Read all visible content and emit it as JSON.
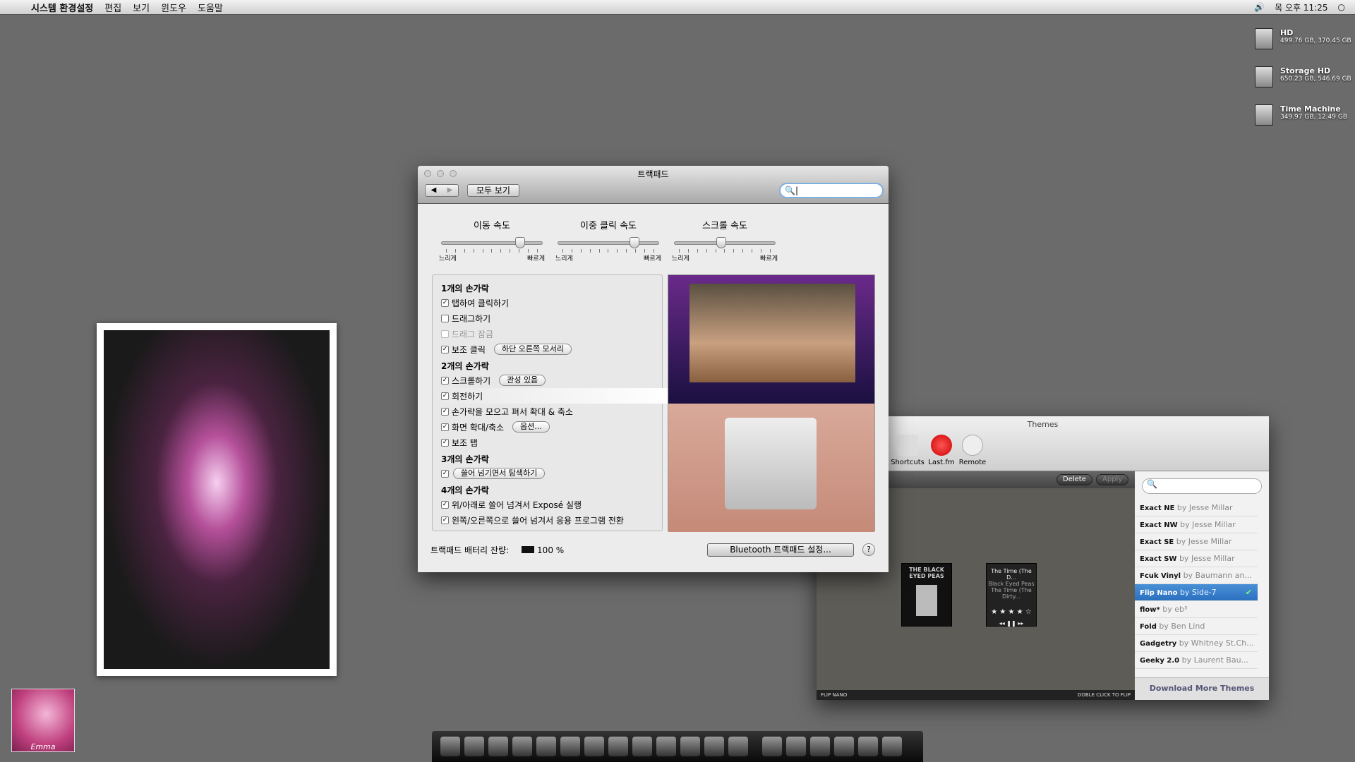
{
  "menubar": {
    "app": "시스템 환경설정",
    "items": [
      "편집",
      "보기",
      "윈도우",
      "도움말"
    ],
    "clock": "목 오후 11:25"
  },
  "drives": [
    {
      "name": "HD",
      "size": "499.76 GB, 370.45 GB"
    },
    {
      "name": "Storage HD",
      "size": "650.23 GB, 546.69 GB"
    },
    {
      "name": "Time Machine",
      "size": "349.97 GB, 12.49 GB"
    }
  ],
  "album": {
    "label": "Emma"
  },
  "trackpad": {
    "title": "트랙패드",
    "show_all": "모두 보기",
    "search_value": "",
    "sliders": [
      {
        "label": "이동 속도",
        "min": "느리게",
        "max": "빠르게",
        "value": 0.8
      },
      {
        "label": "이중 클릭 속도",
        "min": "느리게",
        "max": "빠르게",
        "value": 0.78
      },
      {
        "label": "스크롤 속도",
        "min": "느리게",
        "max": "빠르게",
        "value": 0.45
      }
    ],
    "groups": {
      "one": "1개의 손가락",
      "two": "2개의 손가락",
      "three": "3개의 손가락",
      "four": "4개의 손가락"
    },
    "options": {
      "tap": "탭하여 클릭하기",
      "drag": "드래그하기",
      "draglock": "드래그 잠금",
      "secondary": "보조 클릭",
      "secondary_pop": "하단 오른쪽 모서리",
      "scroll": "스크롤하기",
      "scroll_pop": "관성 있음",
      "rotate": "회전하기",
      "pinch": "손가락을 모으고 펴서 확대 & 축소",
      "zoom": "화면 확대/축소",
      "zoom_btn": "옵션...",
      "sectap": "보조 탭",
      "swipe_pop": "쓸어 넘기면서 탐색하기",
      "expose": "위/아래로 쓸어 넘겨서 Exposé 실행",
      "appswitch": "왼쪽/오른쪽으로 쓸어 넘겨서 응용 프로그램 전환"
    },
    "battery_label": "트랙패드 배터리 잔량:",
    "battery": "100 %",
    "bt_button": "Bluetooth 트랙패드 설정...",
    "help": "?"
  },
  "themes": {
    "title": "Themes",
    "tools": [
      "Shortcuts",
      "Last.fm",
      "Remote"
    ],
    "delete": "Delete",
    "apply": "Apply",
    "widget": {
      "track": "The Time (The D...",
      "artist": "Black Eyed Peas",
      "album": "The Time (The Dirty...",
      "rating": "★ ★ ★ ★ ☆",
      "controls": "◂◂  ❚❚  ▸▸",
      "cover": "THE BLACK EYED PEAS"
    },
    "footer_left": "FLIP NANO",
    "footer_right": "DOBLE CLICK TO FLIP",
    "list": [
      {
        "n": "Exact NE",
        "a": "by Jesse Millar"
      },
      {
        "n": "Exact NW",
        "a": "by Jesse Millar"
      },
      {
        "n": "Exact SE",
        "a": "by Jesse Millar"
      },
      {
        "n": "Exact SW",
        "a": "by Jesse Millar"
      },
      {
        "n": "Fcuk Vinyl",
        "a": "by Baumann an..."
      },
      {
        "n": "Flip Nano",
        "a": "by Side-7"
      },
      {
        "n": "flow*",
        "a": "by eb³"
      },
      {
        "n": "Fold",
        "a": "by Ben Lind"
      },
      {
        "n": "Gadgetry",
        "a": "by Whitney St.Ch..."
      },
      {
        "n": "Geeky 2.0",
        "a": "by Laurent Bau..."
      }
    ],
    "download": "Download More Themes"
  },
  "dock": [
    "finder-icon",
    "candy-icon",
    "itunes-icon",
    "truck-icon",
    "safari-icon",
    "camera-icon",
    "video-icon",
    "firefox-icon",
    "preview-icon",
    "run-dmc-icon",
    "photo-icon",
    "cowboy-icon",
    "system-prefs-icon",
    "cowboy-folder-icon",
    "folder-icon",
    "folder-icon",
    "desktop-icon",
    "desktop-icon",
    "trash-icon"
  ]
}
